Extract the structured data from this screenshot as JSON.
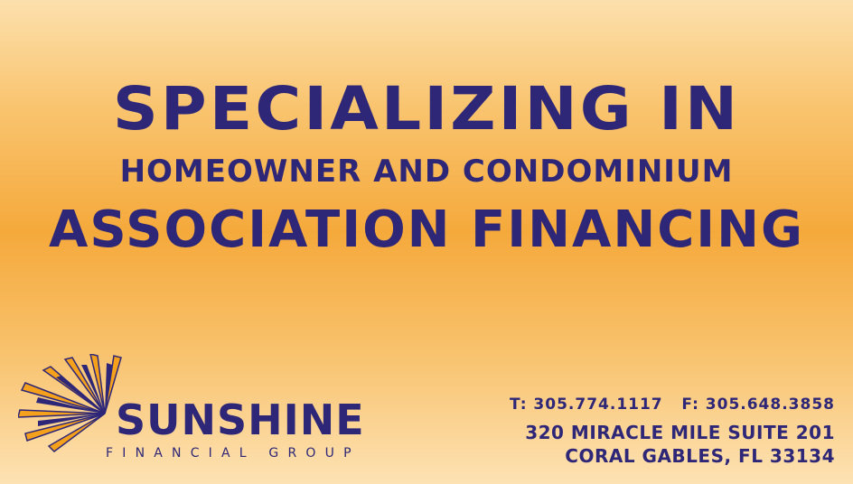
{
  "headline": {
    "line1": "SPECIALIZING IN",
    "line2": "HOMEOWNER AND CONDOMINIUM",
    "line3": "ASSOCIATION FINANCING"
  },
  "logo": {
    "name": "SUNSHINE",
    "subtitle": "FINANCIAL GROUP",
    "icon": "sunburst-icon"
  },
  "contact": {
    "phones": "T: 305.774.1117   F: 305.648.3858",
    "address_line1": "320 MIRACLE MILE SUITE 201",
    "address_line2": "CORAL GABLES, FL 33134"
  },
  "colors": {
    "text": "#2e2778",
    "background_top": "#fce0ad",
    "background_mid": "#f5a93b",
    "ray_orange": "#f6a11c"
  }
}
